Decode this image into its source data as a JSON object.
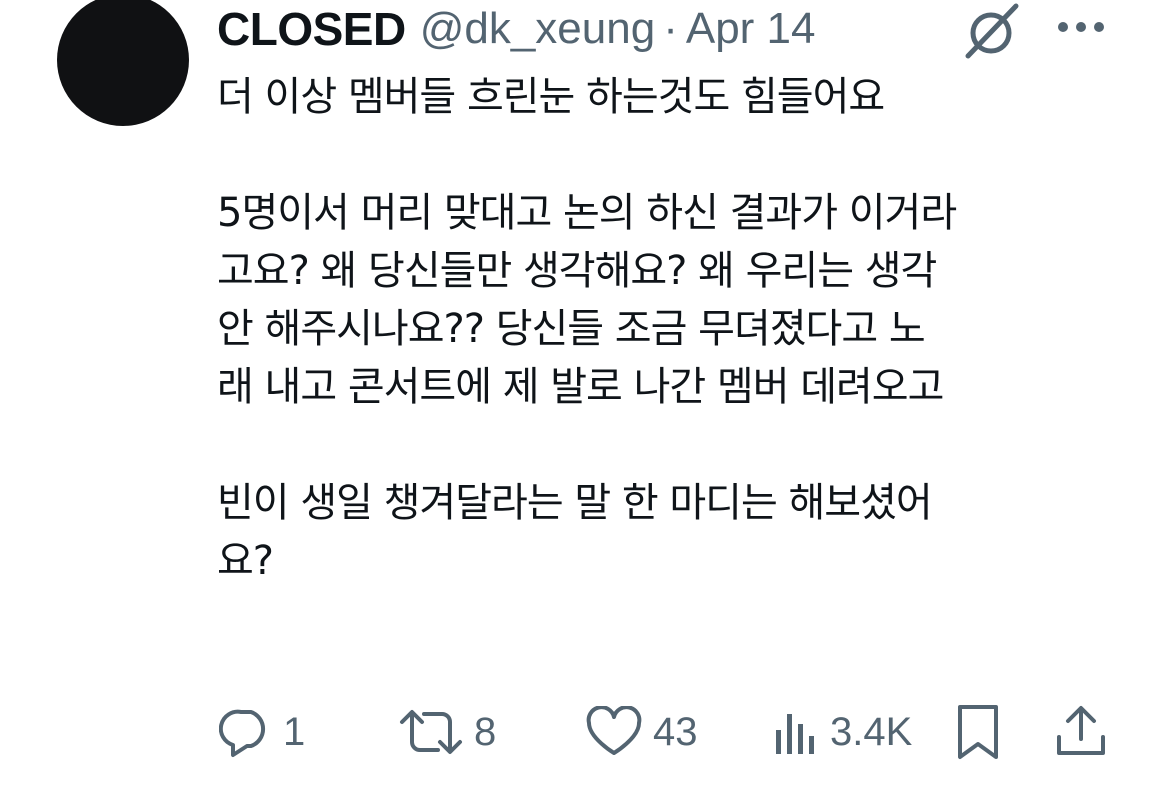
{
  "author": {
    "name": "CLOSED",
    "handle": "@dk_xeung",
    "separator": "·",
    "date": "Apr 14"
  },
  "header_icons": {
    "grok": "grok-icon",
    "more": "more-options-icon"
  },
  "tweet": {
    "paragraphs": [
      "더 이상 멤버들 흐린눈 하는것도 힘들어요",
      "5명이서 머리 맞대고 논의 하신 결과가 이거라고요? 왜 당신들만 생각해요? 왜 우리는 생각안 해주시나요?? 당신들 조금 무뎌졌다고 노래 내고 콘서트에 제 발로 나간 멤버 데려오고",
      "빈이 생일 챙겨달라는 말 한 마디는 해보셨어요?"
    ],
    "lines": [
      "더 이상 멤버들 흐린눈 하는것도 힘들어요",
      "5명이서 머리 맞대고 논의 하신 결과가 이거라",
      "고요? 왜 당신들만 생각해요? 왜 우리는 생각",
      "안 해주시나요?? 당신들 조금 무뎌졌다고 노",
      "래 내고 콘서트에 제 발로 나간 멤버 데려오고",
      "빈이 생일 챙겨달라는 말 한 마디는 해보셨어",
      "요?"
    ]
  },
  "actions": {
    "reply": {
      "icon": "reply-icon",
      "count": "1"
    },
    "retweet": {
      "icon": "retweet-icon",
      "count": "8"
    },
    "like": {
      "icon": "like-icon",
      "count": "43"
    },
    "views": {
      "icon": "views-icon",
      "count": "3.4K"
    },
    "bookmark": {
      "icon": "bookmark-icon"
    },
    "share": {
      "icon": "share-icon"
    }
  },
  "colors": {
    "text_primary": "#0f1419",
    "text_secondary": "#536471",
    "avatar": "#101113",
    "background": "#ffffff"
  }
}
